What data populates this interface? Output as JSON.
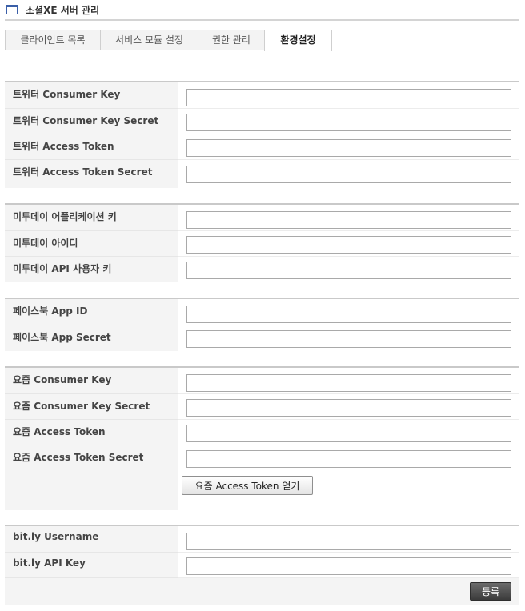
{
  "page": {
    "title": "소셜XE 서버 관리"
  },
  "tabs": [
    {
      "label": "클라이언트 목록"
    },
    {
      "label": "서비스 모듈 설정"
    },
    {
      "label": "권한 관리"
    },
    {
      "label": "환경설정"
    }
  ],
  "twitter": {
    "consumer_key": "트위터 Consumer Key",
    "consumer_key_secret": "트위터 Consumer Key Secret",
    "access_token": "트위터 Access Token",
    "access_token_secret": "트위터 Access Token Secret"
  },
  "me2day": {
    "app_key": "미투데이 어플리케이션 키",
    "id": "미투데이 아이디",
    "api_user_key": "미투데이 API 사용자 키"
  },
  "facebook": {
    "app_id": "페이스북 App ID",
    "app_secret": "페이스북 App Secret"
  },
  "yozm": {
    "consumer_key": "요즘 Consumer Key",
    "consumer_key_secret": "요즘 Consumer Key Secret",
    "access_token": "요즘 Access Token",
    "access_token_secret": "요즘 Access Token Secret",
    "get_token_button": "요즘 Access Token 얻기"
  },
  "bitly": {
    "username": "bit.ly Username",
    "api_key": "bit.ly API Key"
  },
  "actions": {
    "submit": "등록"
  }
}
